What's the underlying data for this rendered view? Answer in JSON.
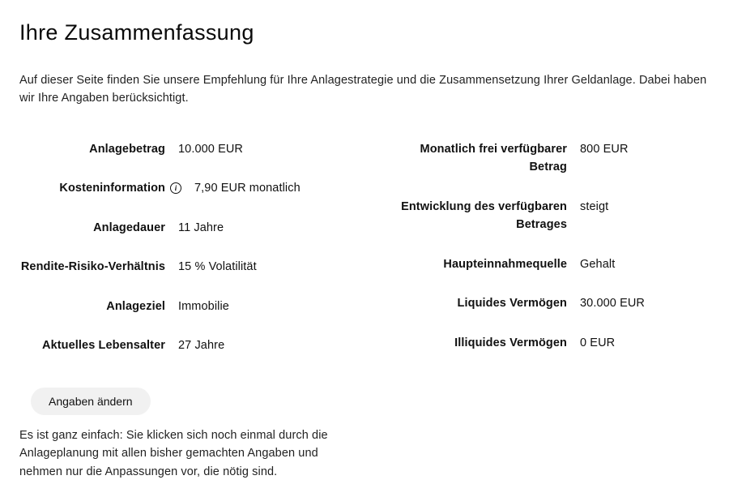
{
  "title": "Ihre Zusammenfassung",
  "intro": "Auf dieser Seite finden Sie unsere Empfehlung für Ihre Anlagestrategie und die Zusammensetzung Ihrer Geldanlage. Dabei haben wir Ihre Angaben berücksichtigt.",
  "left": {
    "anlagebetrag": {
      "label": "Anlagebetrag",
      "value": "10.000 EUR"
    },
    "kosten": {
      "label": "Kosteninformation",
      "value": "7,90 EUR monatlich"
    },
    "dauer": {
      "label": "Anlagedauer",
      "value": "11 Jahre"
    },
    "rendite": {
      "label": "Rendite-Risiko-Verhältnis",
      "value": "15 % Volatilität"
    },
    "ziel": {
      "label": "Anlageziel",
      "value": "Immobilie"
    },
    "alter": {
      "label": "Aktuelles Lebensalter",
      "value": "27 Jahre"
    }
  },
  "right": {
    "monatlich": {
      "label": "Monatlich frei verfügbarer Betrag",
      "value": "800 EUR"
    },
    "entwicklung": {
      "label": "Entwicklung des verfügba­ren Betrages",
      "value": "steigt"
    },
    "einnahme": {
      "label": "Haupteinnahmequelle",
      "value": "Gehalt"
    },
    "liquide": {
      "label": "Liquides Vermögen",
      "value": "30.000 EUR"
    },
    "illiquide": {
      "label": "Illiquides Vermögen",
      "value": "0 EUR"
    }
  },
  "button": "Angaben ändern",
  "hint": "Es ist ganz einfach: Sie klicken sich noch einmal durch die Anlageplanung mit allen bisher gemachten Angaben und nehmen nur die Anpassungen vor, die nötig sind."
}
